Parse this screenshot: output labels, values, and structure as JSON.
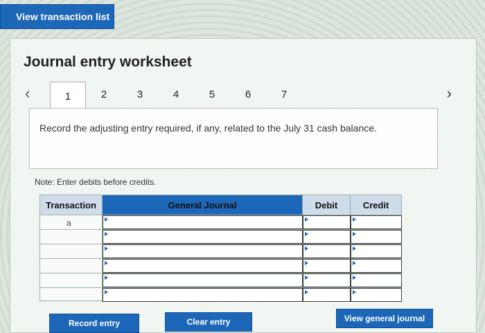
{
  "top_button": {
    "label": "View transaction list"
  },
  "worksheet": {
    "title": "Journal entry worksheet",
    "pages": [
      "1",
      "2",
      "3",
      "4",
      "5",
      "6",
      "7"
    ],
    "active_page": "1",
    "prompt": "Record the adjusting entry required, if any, related to the July 31 cash balance.",
    "note": "Note: Enter debits before credits."
  },
  "table": {
    "headers": {
      "transaction": "Transaction",
      "general_journal": "General Journal",
      "debit": "Debit",
      "credit": "Credit"
    },
    "rows": [
      {
        "transaction": "a"
      },
      {
        "transaction": ""
      },
      {
        "transaction": ""
      },
      {
        "transaction": ""
      },
      {
        "transaction": ""
      },
      {
        "transaction": ""
      }
    ]
  },
  "buttons": {
    "record_entry": "Record entry",
    "clear_entry": "Clear entry",
    "view_general_journal": "View general journal"
  },
  "icons": {
    "prev": "chevron-left-icon",
    "next": "chevron-right-icon"
  },
  "colors": {
    "accent": "#1d67b8"
  }
}
